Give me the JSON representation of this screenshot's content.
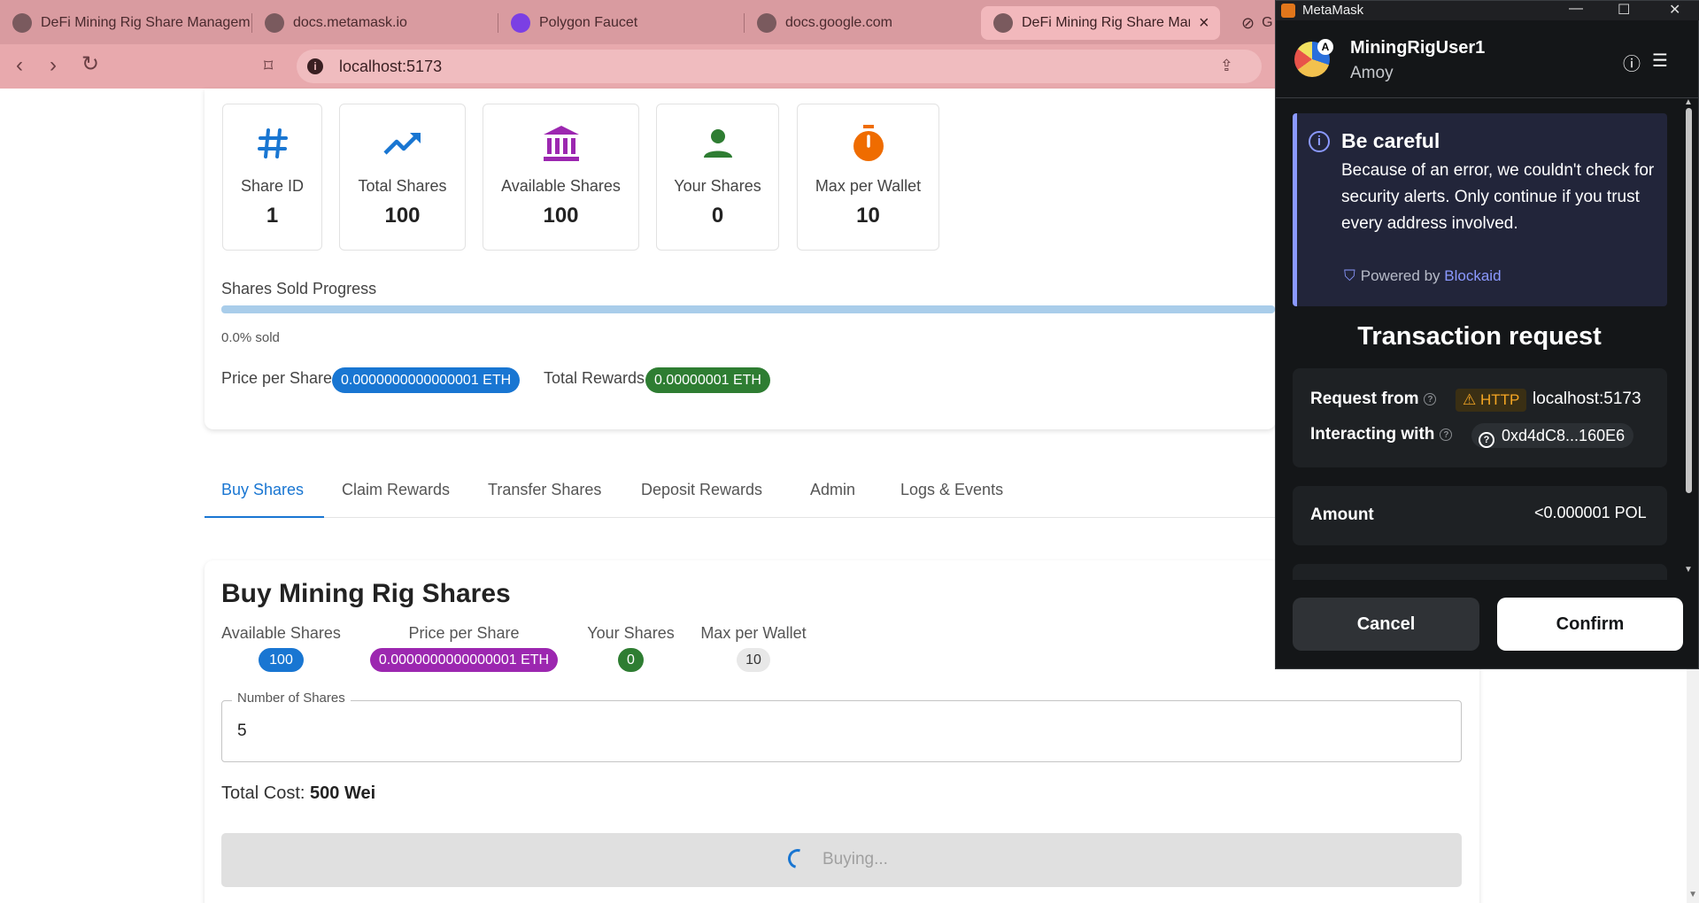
{
  "browser": {
    "tabs": [
      {
        "title": "DeFi Mining Rig Share Managem",
        "active": false
      },
      {
        "title": "docs.metamask.io",
        "active": false
      },
      {
        "title": "Polygon Faucet",
        "active": false
      },
      {
        "title": "docs.google.com",
        "active": false
      },
      {
        "title": "DeFi Mining Rig Share Man",
        "active": true
      },
      {
        "title": "G",
        "active": false
      }
    ],
    "url": "localhost:5173"
  },
  "stats": [
    {
      "icon": "hash-icon",
      "label": "Share ID",
      "value": "1",
      "color": "#1976d2"
    },
    {
      "icon": "trending-up-icon",
      "label": "Total Shares",
      "value": "100",
      "color": "#1976d2"
    },
    {
      "icon": "bank-icon",
      "label": "Available Shares",
      "value": "100",
      "color": "#9c27b0"
    },
    {
      "icon": "person-icon",
      "label": "Your Shares",
      "value": "0",
      "color": "#2e7d32"
    },
    {
      "icon": "timer-icon",
      "label": "Max per Wallet",
      "value": "10",
      "color": "#ef6c00"
    }
  ],
  "progress": {
    "label": "Shares Sold Progress",
    "sold_fraction": 0.0,
    "text": "0.0% sold"
  },
  "pricing": {
    "price_label": "Price per Share",
    "price_value": "0.0000000000000001 ETH",
    "rewards_label": "Total Rewards",
    "rewards_value": "0.00000001 ETH",
    "price_color": "#1976d2",
    "rewards_color": "#2e7d32"
  },
  "tabs": [
    {
      "label": "Buy Shares",
      "active": true
    },
    {
      "label": "Claim Rewards",
      "active": false
    },
    {
      "label": "Transfer Shares",
      "active": false
    },
    {
      "label": "Deposit Rewards",
      "active": false
    },
    {
      "label": "Admin",
      "active": false
    },
    {
      "label": "Logs & Events",
      "active": false
    }
  ],
  "buy": {
    "title": "Buy Mining Rig Shares",
    "info": [
      {
        "label": "Available Shares",
        "value": "100",
        "color": "#1976d2"
      },
      {
        "label": "Price per Share",
        "value": "0.0000000000000001 ETH",
        "color": "#9c27b0"
      },
      {
        "label": "Your Shares",
        "value": "0",
        "color": "#2e7d32"
      },
      {
        "label": "Max per Wallet",
        "value": "10",
        "color": "#e8e8e8"
      }
    ],
    "field_label": "Number of Shares",
    "field_value": "5",
    "total_cost_label": "Total Cost:",
    "total_cost_value": "500 Wei",
    "button_label": "Buying..."
  },
  "metamask": {
    "window_title": "MetaMask",
    "account": "MiningRigUser1",
    "network": "Amoy",
    "network_badge": "A",
    "warning": {
      "title": "Be careful",
      "body": "Because of an error, we couldn't check for security alerts. Only continue if you trust every address involved.",
      "powered_by": "Powered by",
      "provider": "Blockaid"
    },
    "tx_title": "Transaction request",
    "request_from_label": "Request from",
    "http_badge": "HTTP",
    "request_from_value": "localhost:5173",
    "interacting_with_label": "Interacting with",
    "interacting_with_value": "0xd4dC8...160E6",
    "amount_label": "Amount",
    "amount_value": "<0.000001 POL",
    "cancel_label": "Cancel",
    "confirm_label": "Confirm",
    "accent": "#8b99ff"
  }
}
